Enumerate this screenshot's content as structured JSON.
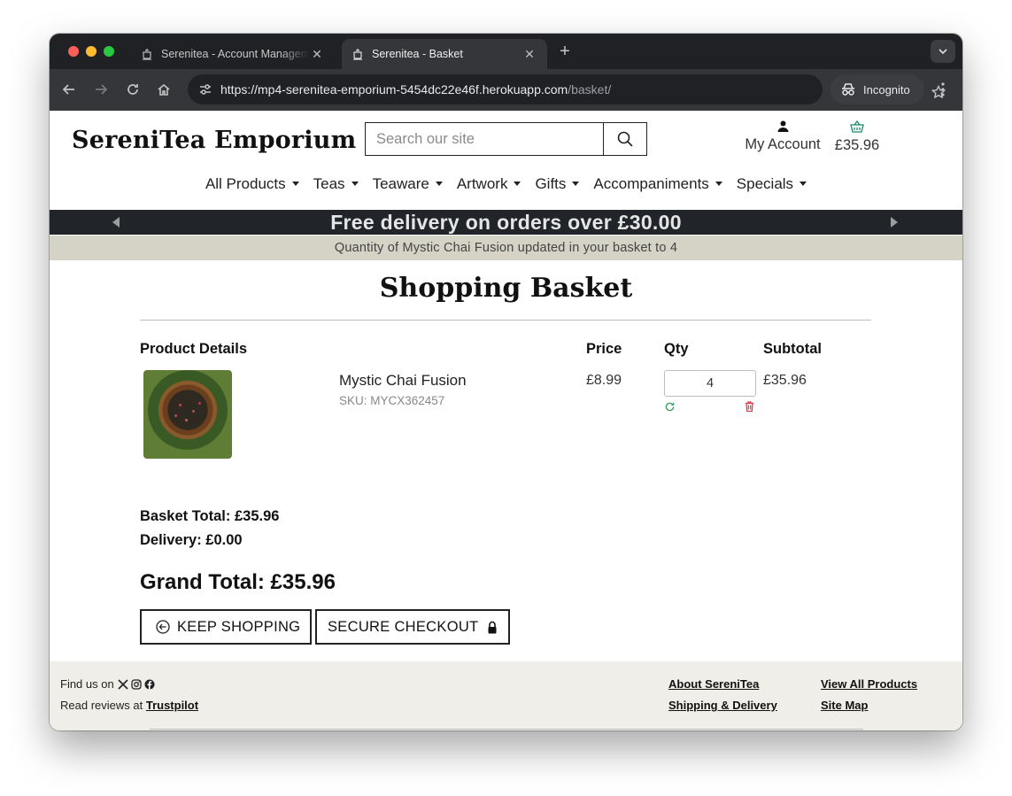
{
  "browser": {
    "tabs": [
      {
        "title": "Serenitea - Account Management",
        "close": "✕"
      },
      {
        "title": "Serenitea - Basket",
        "close": "✕"
      }
    ],
    "new_tab": "+",
    "url_host": "https://mp4-serenitea-emporium-5454dc22e46f.herokuapp.com",
    "url_path": "/basket/",
    "incognito_label": "Incognito"
  },
  "header": {
    "brand": "SereniTea Emporium",
    "search_placeholder": "Search our site",
    "account_label": "My Account",
    "basket_total": "£35.96"
  },
  "nav": {
    "items": [
      "All Products",
      "Teas",
      "Teaware",
      "Artwork",
      "Gifts",
      "Accompaniments",
      "Specials"
    ]
  },
  "banner": {
    "text": "Free delivery on orders over £30.00"
  },
  "notice": {
    "text": "Quantity of Mystic Chai Fusion updated in your basket to 4"
  },
  "basket": {
    "title": "Shopping Basket",
    "headers": {
      "product": "Product Details",
      "price": "Price",
      "qty": "Qty",
      "subtotal": "Subtotal"
    },
    "items": [
      {
        "name": "Mystic Chai Fusion",
        "sku": "SKU: MYCX362457",
        "price": "£8.99",
        "qty": "4",
        "subtotal": "£35.96"
      }
    ],
    "basket_total": "Basket Total: £35.96",
    "delivery": "Delivery: £0.00",
    "grand_total": "Grand Total: £35.96",
    "keep_shopping": "KEEP SHOPPING",
    "secure_checkout": "SECURE CHECKOUT"
  },
  "footer": {
    "find_us": "Find us on",
    "reviews_prefix": "Read reviews at",
    "reviews_link": "Trustpilot",
    "links": [
      "About SereniTea",
      "Shipping & Delivery",
      "View All Products",
      "Site Map"
    ]
  },
  "colors": {
    "banner_bg": "#212529",
    "notice_bg": "#d4d3c6",
    "footer_bg": "#efeee8",
    "basket_icon": "#1a8a6a",
    "update_icon": "#2e9b5b",
    "remove_icon": "#dc3545"
  }
}
